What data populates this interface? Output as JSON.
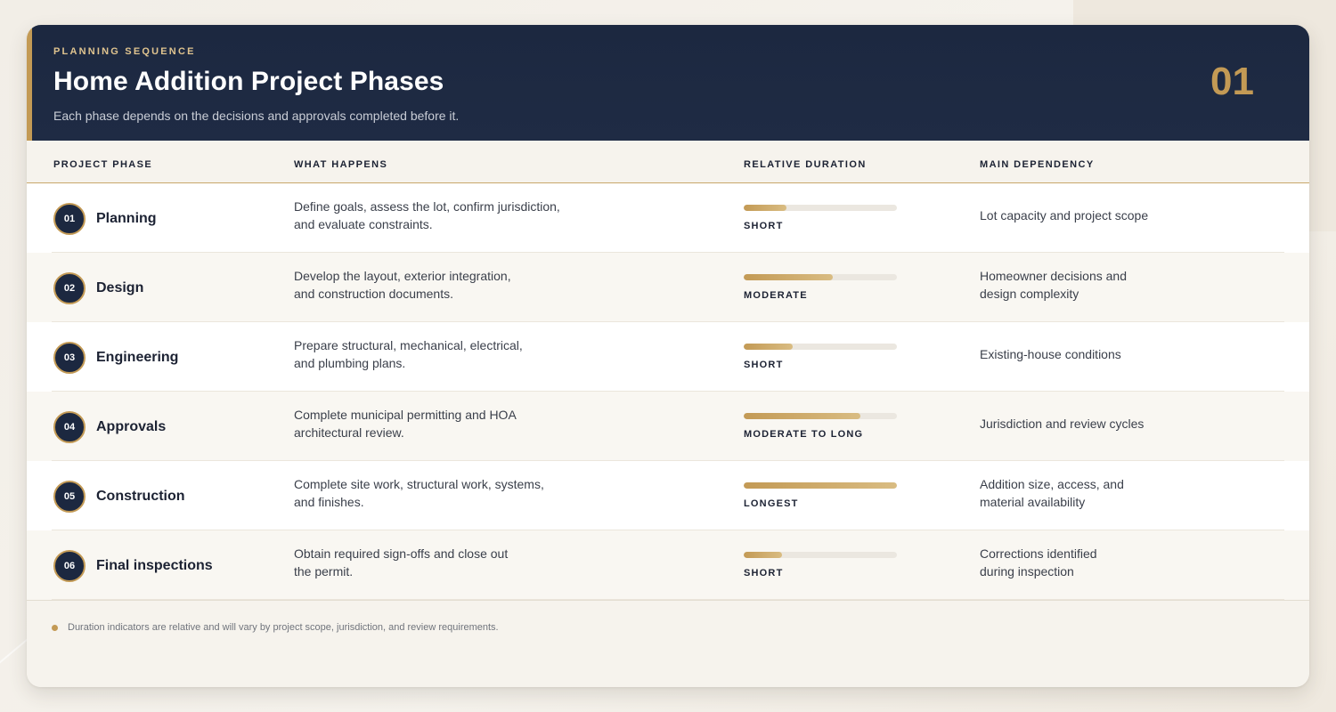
{
  "header": {
    "eyebrow": "PLANNING SEQUENCE",
    "title": "Home Addition Project Phases",
    "subtitle": "Each phase depends on the decisions and approvals completed before it.",
    "number": "01"
  },
  "columns": [
    "PROJECT PHASE",
    "WHAT HAPPENS",
    "RELATIVE DURATION",
    "MAIN DEPENDENCY"
  ],
  "rows": [
    {
      "num": "01",
      "phase": "Planning",
      "what_1": "Define goals, assess the lot, confirm jurisdiction,",
      "what_2": "and evaluate constraints.",
      "duration_label": "SHORT",
      "duration_fraction": 0.28,
      "dep_1": "Lot capacity and project scope",
      "dep_2": ""
    },
    {
      "num": "02",
      "phase": "Design",
      "what_1": "Develop the layout, exterior integration,",
      "what_2": "and construction documents.",
      "duration_label": "MODERATE",
      "duration_fraction": 0.58,
      "dep_1": "Homeowner decisions and",
      "dep_2": "design complexity"
    },
    {
      "num": "03",
      "phase": "Engineering",
      "what_1": "Prepare structural, mechanical, electrical,",
      "what_2": "and plumbing plans.",
      "duration_label": "SHORT",
      "duration_fraction": 0.32,
      "dep_1": "Existing-house conditions",
      "dep_2": ""
    },
    {
      "num": "04",
      "phase": "Approvals",
      "what_1": "Complete municipal permitting and HOA",
      "what_2": "architectural review.",
      "duration_label": "MODERATE TO LONG",
      "duration_fraction": 0.76,
      "dep_1": "Jurisdiction and review cycles",
      "dep_2": ""
    },
    {
      "num": "05",
      "phase": "Construction",
      "what_1": "Complete site work, structural work, systems,",
      "what_2": "and finishes.",
      "duration_label": "LONGEST",
      "duration_fraction": 1.0,
      "dep_1": "Addition size, access, and",
      "dep_2": "material availability"
    },
    {
      "num": "06",
      "phase": "Final inspections",
      "what_1": "Obtain required sign-offs and close out",
      "what_2": "the permit.",
      "duration_label": "SHORT",
      "duration_fraction": 0.25,
      "dep_1": "Corrections identified",
      "dep_2": "during inspection"
    }
  ],
  "footer": {
    "note": "Duration indicators are relative and will vary by project scope, jurisdiction, and review requirements."
  },
  "colors": {
    "navy": "#1c2840",
    "gold": "#c39a55",
    "background": "#f6f3ed"
  }
}
